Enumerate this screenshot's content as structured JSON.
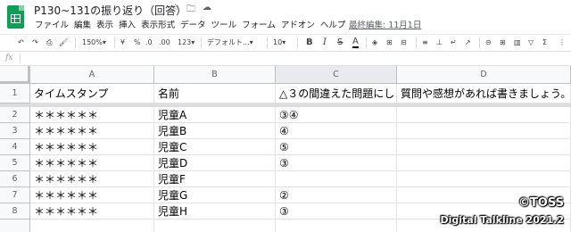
{
  "document": {
    "title": "P130~131の振り返り（回答）",
    "last_edit": "最終編集: 11月1日"
  },
  "title_icons": {
    "star": "☆",
    "folder": "🗀",
    "cloud": "☁"
  },
  "menu": [
    "ファイル",
    "編集",
    "表示",
    "挿入",
    "表示形式",
    "データ",
    "ツール",
    "フォーム",
    "アドオン",
    "ヘルプ"
  ],
  "toolbar": {
    "undo": "↶",
    "redo": "↷",
    "print": "⎙",
    "paint_format": "🖌",
    "zoom": "150%",
    "zoom_caret": "▾",
    "currency": "¥",
    "percent": "%",
    "decrease_decimal": ".0",
    "increase_decimal": ".00",
    "more_formats": "123▾",
    "font": "デフォルト...",
    "font_caret": "▾",
    "font_size": "10",
    "font_size_caret": "▾",
    "bold": "B",
    "italic": "I",
    "strikethrough": "S",
    "text_color": "A",
    "fill_color": "◈",
    "borders": "⊞",
    "merge": "⊟",
    "halign": "≡",
    "valign": "⊥",
    "wrap": "↵",
    "rotate": "↗",
    "link": "⊝",
    "comment": "⊞",
    "chart": "▥",
    "filter": "▽",
    "functions": "Σ",
    "more": "⋮"
  },
  "formula_bar": {
    "fx": "fx",
    "value": ""
  },
  "columns": [
    "A",
    "B",
    "C",
    "D"
  ],
  "rows": [
    {
      "num": "1",
      "cells": [
        "タイムスタンプ",
        "名前",
        "△３の間違えた問題にし",
        "質問や感想があれば書きましょう。"
      ]
    },
    {
      "num": "2",
      "cells": [
        "＊＊＊＊＊＊",
        "児童A",
        "③④",
        ""
      ]
    },
    {
      "num": "3",
      "cells": [
        "＊＊＊＊＊＊",
        "児童B",
        "④",
        ""
      ]
    },
    {
      "num": "4",
      "cells": [
        "＊＊＊＊＊＊",
        "児童C",
        "⑤",
        ""
      ]
    },
    {
      "num": "5",
      "cells": [
        "＊＊＊＊＊＊",
        "児童D",
        "③",
        ""
      ]
    },
    {
      "num": "6",
      "cells": [
        "＊＊＊＊＊＊",
        "児童F",
        "",
        ""
      ]
    },
    {
      "num": "7",
      "cells": [
        "＊＊＊＊＊＊",
        "児童G",
        "②",
        ""
      ]
    },
    {
      "num": "8",
      "cells": [
        "＊＊＊＊＊＊",
        "児童H",
        "③",
        ""
      ]
    }
  ],
  "watermark": {
    "line1": "©TOSS",
    "line2": "Digital Talkline 2021.2"
  },
  "colors": {
    "accent": "#1a73e8",
    "sheets_green": "#0f9d58"
  }
}
